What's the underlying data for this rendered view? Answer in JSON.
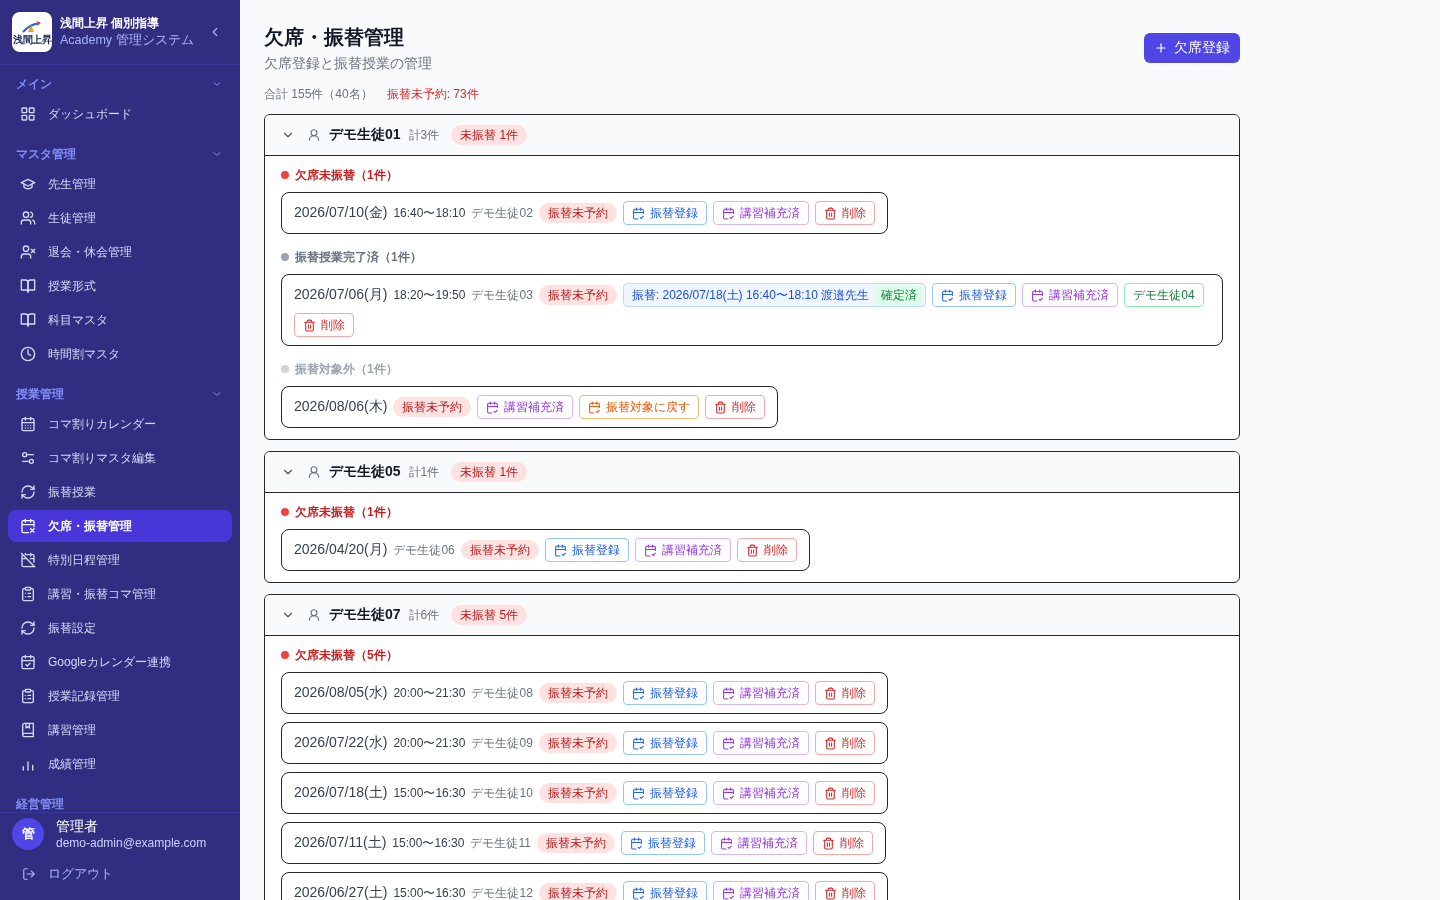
{
  "sidebar": {
    "logo_text": "浅間上昇",
    "title": "浅間上昇 個別指導",
    "subtitle": "Academy 管理システム",
    "groups": [
      {
        "label": "メイン",
        "expanded": true,
        "items": [
          {
            "label": "ダッシュボード",
            "selected": false
          }
        ]
      },
      {
        "label": "マスタ管理",
        "expanded": true,
        "items": [
          {
            "label": "先生管理",
            "selected": false
          },
          {
            "label": "生徒管理",
            "selected": false
          },
          {
            "label": "退会・休会管理",
            "selected": false
          },
          {
            "label": "授業形式",
            "selected": false
          },
          {
            "label": "科目マスタ",
            "selected": false
          },
          {
            "label": "時間割マスタ",
            "selected": false
          }
        ]
      },
      {
        "label": "授業管理",
        "expanded": true,
        "items": [
          {
            "label": "コマ割りカレンダー",
            "selected": false
          },
          {
            "label": "コマ割りマスタ編集",
            "selected": false
          },
          {
            "label": "振替授業",
            "selected": false
          },
          {
            "label": "欠席・振替管理",
            "selected": true
          },
          {
            "label": "特別日程管理",
            "selected": false
          },
          {
            "label": "講習・振替コマ管理",
            "selected": false
          },
          {
            "label": "振替設定",
            "selected": false
          },
          {
            "label": "Googleカレンダー連携",
            "selected": false
          },
          {
            "label": "授業記録管理",
            "selected": false
          },
          {
            "label": "講習管理",
            "selected": false
          },
          {
            "label": "成績管理",
            "selected": false
          }
        ]
      },
      {
        "label": "経営管理"
      }
    ],
    "user": {
      "avatar": "管",
      "name": "管理者",
      "email": "demo-admin@example.com"
    },
    "logout": "ログアウト"
  },
  "page": {
    "title": "欠席・振替管理",
    "subtitle": "欠席登録と振替授業の管理",
    "add_button": "欠席登録",
    "total": "合計 155件（40名）",
    "unbooked": "振替未予約: 73件"
  },
  "students": [
    {
      "name": "デモ生徒01",
      "count": "計3件",
      "badge": "未振替 1件",
      "expanded": true,
      "sections": [
        {
          "kind": "pending",
          "label": "欠席未振替（1件）",
          "rows": [
            {
              "date": "2026/07/10(金)",
              "time": "16:40〜18:10",
              "student": "デモ生徒02",
              "status": "振替未予約",
              "actions": [
                {
                  "kind": "reschedule",
                  "label": "振替登録"
                },
                {
                  "kind": "makeup",
                  "label": "講習補充済"
                },
                {
                  "kind": "delete",
                  "label": "削除"
                }
              ]
            }
          ]
        },
        {
          "kind": "done",
          "label": "振替授業完了済（1件）",
          "rows": [
            {
              "date": "2026/07/06(月)",
              "time": "18:20〜19:50",
              "student": "デモ生徒03",
              "status": "振替未予約",
              "transfer": {
                "text": "振替: 2026/07/18(土) 16:40〜18:10 渡邉先生",
                "status": "確定済"
              },
              "actions": [
                {
                  "kind": "reschedule",
                  "label": "振替登録"
                },
                {
                  "kind": "makeup",
                  "label": "講習補充済"
                },
                {
                  "kind": "student",
                  "label": "デモ生徒04"
                },
                {
                  "kind": "delete",
                  "label": "削除"
                }
              ]
            }
          ]
        },
        {
          "kind": "excluded",
          "label": "振替対象外（1件）",
          "rows": [
            {
              "date": "2026/08/06(木)",
              "status": "振替未予約",
              "actions": [
                {
                  "kind": "makeup",
                  "label": "講習補充済"
                },
                {
                  "kind": "restore",
                  "label": "振替対象に戻す"
                },
                {
                  "kind": "delete",
                  "label": "削除"
                }
              ]
            }
          ]
        }
      ]
    },
    {
      "name": "デモ生徒05",
      "count": "計1件",
      "badge": "未振替 1件",
      "expanded": true,
      "sections": [
        {
          "kind": "pending",
          "label": "欠席未振替（1件）",
          "rows": [
            {
              "date": "2026/04/20(月)",
              "student": "デモ生徒06",
              "status": "振替未予約",
              "actions": [
                {
                  "kind": "reschedule",
                  "label": "振替登録"
                },
                {
                  "kind": "makeup",
                  "label": "講習補充済"
                },
                {
                  "kind": "delete",
                  "label": "削除"
                }
              ]
            }
          ]
        }
      ]
    },
    {
      "name": "デモ生徒07",
      "count": "計6件",
      "badge": "未振替 5件",
      "expanded": true,
      "sections": [
        {
          "kind": "pending",
          "label": "欠席未振替（5件）",
          "rows": [
            {
              "date": "2026/08/05(水)",
              "time": "20:00〜21:30",
              "student": "デモ生徒08",
              "status": "振替未予約",
              "actions": [
                {
                  "kind": "reschedule",
                  "label": "振替登録"
                },
                {
                  "kind": "makeup",
                  "label": "講習補充済"
                },
                {
                  "kind": "delete",
                  "label": "削除"
                }
              ]
            },
            {
              "date": "2026/07/22(水)",
              "time": "20:00〜21:30",
              "student": "デモ生徒09",
              "status": "振替未予約",
              "actions": [
                {
                  "kind": "reschedule",
                  "label": "振替登録"
                },
                {
                  "kind": "makeup",
                  "label": "講習補充済"
                },
                {
                  "kind": "delete",
                  "label": "削除"
                }
              ]
            },
            {
              "date": "2026/07/18(土)",
              "time": "15:00〜16:30",
              "student": "デモ生徒10",
              "status": "振替未予約",
              "actions": [
                {
                  "kind": "reschedule",
                  "label": "振替登録"
                },
                {
                  "kind": "makeup",
                  "label": "講習補充済"
                },
                {
                  "kind": "delete",
                  "label": "削除"
                }
              ]
            },
            {
              "date": "2026/07/11(土)",
              "time": "15:00〜16:30",
              "student": "デモ生徒11",
              "status": "振替未予約",
              "actions": [
                {
                  "kind": "reschedule",
                  "label": "振替登録"
                },
                {
                  "kind": "makeup",
                  "label": "講習補充済"
                },
                {
                  "kind": "delete",
                  "label": "削除"
                }
              ]
            },
            {
              "date": "2026/06/27(土)",
              "time": "15:00〜16:30",
              "student": "デモ生徒12",
              "status": "振替未予約",
              "actions": [
                {
                  "kind": "reschedule",
                  "label": "振替登録"
                },
                {
                  "kind": "makeup",
                  "label": "講習補充済"
                },
                {
                  "kind": "delete",
                  "label": "削除"
                }
              ]
            }
          ]
        }
      ]
    }
  ]
}
